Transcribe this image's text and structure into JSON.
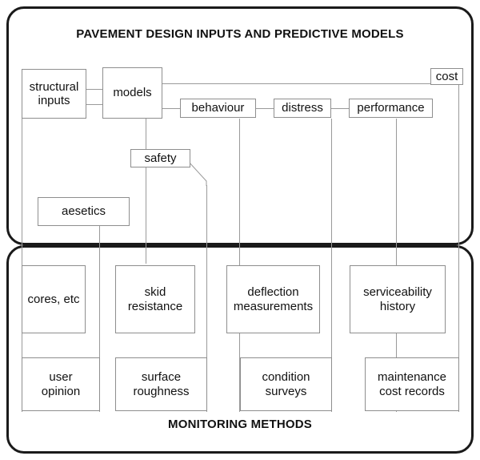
{
  "diagram": {
    "type": "flowchart",
    "top_panel": {
      "title": "PAVEMENT DESIGN INPUTS AND PREDICTIVE MODELS",
      "boxes": [
        {
          "id": "structural_inputs",
          "label": "structural\ninputs"
        },
        {
          "id": "models",
          "label": "models"
        },
        {
          "id": "behaviour",
          "label": "behaviour"
        },
        {
          "id": "distress",
          "label": "distress"
        },
        {
          "id": "performance",
          "label": "performance"
        },
        {
          "id": "cost",
          "label": "cost"
        },
        {
          "id": "safety",
          "label": "safety"
        },
        {
          "id": "aesetics",
          "label": "aesetics"
        }
      ]
    },
    "bottom_panel": {
      "title": "MONITORING METHODS",
      "row1": [
        {
          "id": "cores_etc",
          "label": "cores, etc"
        },
        {
          "id": "skid_resistance",
          "label": "skid\nresistance"
        },
        {
          "id": "deflection_measurements",
          "label": "deflection\nmeasurements"
        },
        {
          "id": "serviceability_history",
          "label": "serviceability\nhistory"
        }
      ],
      "row2": [
        {
          "id": "user_opinion",
          "label": "user\nopinion"
        },
        {
          "id": "surface_roughness",
          "label": "surface\nroughness"
        },
        {
          "id": "condition_surveys",
          "label": "condition\nsurveys"
        },
        {
          "id": "maintenance_cost_records",
          "label": "maintenance\ncost records"
        }
      ]
    },
    "colors": {
      "panel_border": "#1a1a1a",
      "box_border": "#8e8e8e",
      "connector": "#9a9a9a",
      "text": "#111111",
      "background": "#ffffff"
    }
  }
}
